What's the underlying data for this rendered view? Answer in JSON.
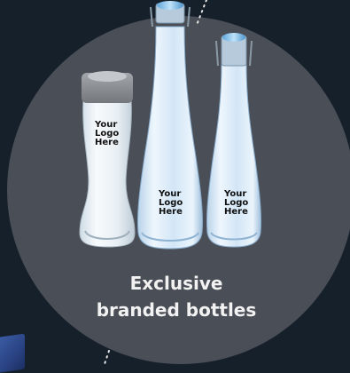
{
  "caption": {
    "line1": "Exclusive",
    "line2": "branded bottles"
  },
  "bottle_logos": [
    {
      "line1": "Your",
      "line2": "Logo",
      "line3": "Here"
    },
    {
      "line1": "Your",
      "line2": "Logo",
      "line3": "Here"
    },
    {
      "line1": "Your",
      "line2": "Logo",
      "line3": "Here"
    }
  ],
  "colors": {
    "background": "#15202b",
    "circle": "#4a4e56",
    "caption_text": "#f2f2f2",
    "cap_grey": "#8c8f94",
    "cap_blue": "#8fc6ec"
  }
}
